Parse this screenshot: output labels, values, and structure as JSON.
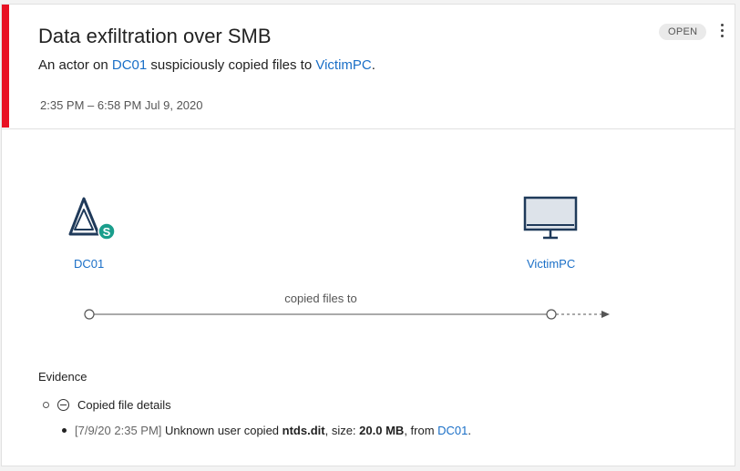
{
  "alert": {
    "title": "Data exfiltration over SMB",
    "description_prefix": "An actor on ",
    "source_entity": "DC01",
    "description_middle": " suspiciously copied files to ",
    "target_entity": "VictimPC",
    "description_suffix": ".",
    "time_range": "2:35 PM – 6:58 PM Jul 9, 2020",
    "status": "OPEN",
    "severity_color": "#e81123"
  },
  "graph": {
    "source_label": "DC01",
    "target_label": "VictimPC",
    "edge_label": "copied files to"
  },
  "evidence": {
    "heading": "Evidence",
    "group_label": "Copied file details",
    "detail": {
      "timestamp": "[7/9/20 2:35 PM]",
      "text_prefix": " Unknown user copied ",
      "file_name": "ntds.dit",
      "text_middle": ", size: ",
      "size": "20.0 MB",
      "text_from": ", from ",
      "source": "DC01",
      "text_suffix": "."
    }
  },
  "colors": {
    "link": "#1a6fc7",
    "accent": "#1a9e8c"
  }
}
